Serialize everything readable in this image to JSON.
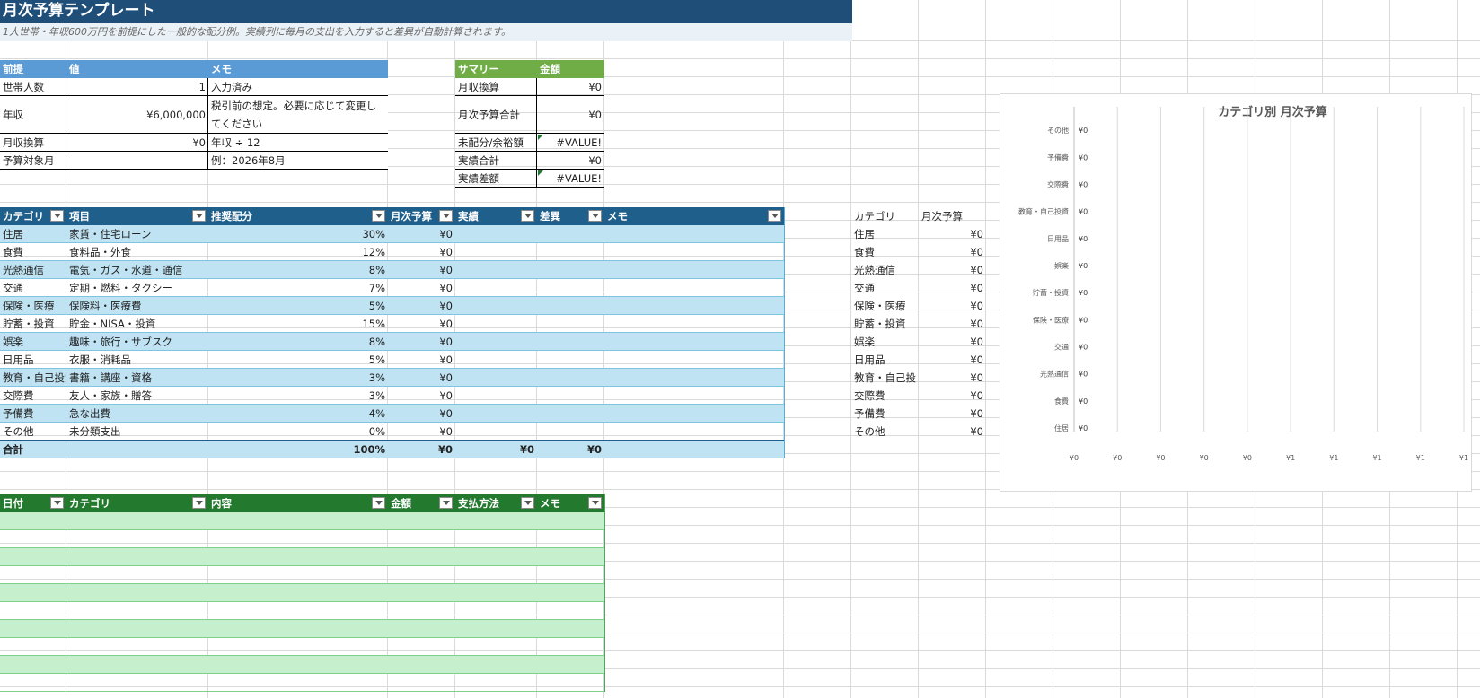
{
  "title": "月次予算テンプレート",
  "subtitle": "1人世帯・年収600万円を前提にした一般的な配分例。実績列に毎月の支出を入力すると差異が自動計算されます。",
  "assumptions": {
    "headers": [
      "前提",
      "値",
      "メモ"
    ],
    "rows": [
      {
        "label": "世帯人数",
        "value": "1",
        "memo": "入力済み",
        "memo2": ""
      },
      {
        "label": "年収",
        "value": "¥6,000,000",
        "memo": "税引前の想定。必要に応じて変更し",
        "memo2": "てください"
      },
      {
        "label": "月収換算",
        "value": "¥0",
        "memo": "年収 ÷ 12",
        "memo2": ""
      },
      {
        "label": "予算対象月",
        "value": "",
        "memo": "例：2026年8月",
        "memo2": ""
      }
    ]
  },
  "summary": {
    "headers": [
      "サマリー",
      "金額"
    ],
    "rows": [
      {
        "label": "月収換算",
        "value": "¥0"
      },
      {
        "label": "月次予算合計",
        "value": "¥0"
      },
      {
        "label": "未配分/余裕額",
        "value": "#VALUE!"
      },
      {
        "label": "実績合計",
        "value": "¥0"
      },
      {
        "label": "実績差額",
        "value": "#VALUE!"
      }
    ]
  },
  "budget": {
    "headers": [
      "カテゴリ",
      "項目",
      "推奨配分",
      "月次予算",
      "実績",
      "差異",
      "メモ"
    ],
    "rows": [
      {
        "cat": "住居",
        "item": "家賃・住宅ローン",
        "pct": "30%",
        "budget": "¥0"
      },
      {
        "cat": "食費",
        "item": "食料品・外食",
        "pct": "12%",
        "budget": "¥0"
      },
      {
        "cat": "光熱通信",
        "item": "電気・ガス・水道・通信",
        "pct": "8%",
        "budget": "¥0"
      },
      {
        "cat": "交通",
        "item": "定期・燃料・タクシー",
        "pct": "7%",
        "budget": "¥0"
      },
      {
        "cat": "保険・医療",
        "item": "保険料・医療費",
        "pct": "5%",
        "budget": "¥0"
      },
      {
        "cat": "貯蓄・投資",
        "item": "貯金・NISA・投資",
        "pct": "15%",
        "budget": "¥0"
      },
      {
        "cat": "娯楽",
        "item": "趣味・旅行・サブスク",
        "pct": "8%",
        "budget": "¥0"
      },
      {
        "cat": "日用品",
        "item": "衣服・消耗品",
        "pct": "5%",
        "budget": "¥0"
      },
      {
        "cat": "教育・自己投資",
        "item": "書籍・講座・資格",
        "pct": "3%",
        "budget": "¥0"
      },
      {
        "cat": "交際費",
        "item": "友人・家族・贈答",
        "pct": "3%",
        "budget": "¥0"
      },
      {
        "cat": "予備費",
        "item": "急な出費",
        "pct": "4%",
        "budget": "¥0"
      },
      {
        "cat": "その他",
        "item": "未分類支出",
        "pct": "0%",
        "budget": "¥0"
      }
    ],
    "total": {
      "label": "合計",
      "pct": "100%",
      "budget": "¥0",
      "actual": "¥0",
      "diff": "¥0"
    }
  },
  "side_list": {
    "headers": [
      "カテゴリ",
      "月次予算"
    ],
    "rows": [
      {
        "cat": "住居",
        "v": "¥0"
      },
      {
        "cat": "食費",
        "v": "¥0"
      },
      {
        "cat": "光熱通信",
        "v": "¥0"
      },
      {
        "cat": "交通",
        "v": "¥0"
      },
      {
        "cat": "保険・医療",
        "v": "¥0"
      },
      {
        "cat": "貯蓄・投資",
        "v": "¥0"
      },
      {
        "cat": "娯楽",
        "v": "¥0"
      },
      {
        "cat": "日用品",
        "v": "¥0"
      },
      {
        "cat": "教育・自己投",
        "v": "¥0"
      },
      {
        "cat": "交際費",
        "v": "¥0"
      },
      {
        "cat": "予備費",
        "v": "¥0"
      },
      {
        "cat": "その他",
        "v": "¥0"
      }
    ]
  },
  "log": {
    "headers": [
      "日付",
      "カテゴリ",
      "内容",
      "金額",
      "支払方法",
      "メモ"
    ],
    "row_count": 10
  },
  "colors": {
    "title": "#1f4e79",
    "bar_grid": "#d9d9d9"
  },
  "chart_data": {
    "type": "bar",
    "orientation": "horizontal",
    "title": "カテゴリ別 月次予算",
    "categories": [
      "その他",
      "予備費",
      "交際費",
      "教育・自己投資",
      "日用品",
      "娯楽",
      "貯蓄・投資",
      "保険・医療",
      "交通",
      "光熱通信",
      "食費",
      "住居"
    ],
    "values": [
      0,
      0,
      0,
      0,
      0,
      0,
      0,
      0,
      0,
      0,
      0,
      0
    ],
    "data_labels": [
      "¥0",
      "¥0",
      "¥0",
      "¥0",
      "¥0",
      "¥0",
      "¥0",
      "¥0",
      "¥0",
      "¥0",
      "¥0",
      "¥0"
    ],
    "x_ticks": [
      "¥0",
      "¥0",
      "¥0",
      "¥0",
      "¥0",
      "¥1",
      "¥1",
      "¥1",
      "¥1",
      "¥1"
    ],
    "grid": true,
    "legend": "none"
  }
}
